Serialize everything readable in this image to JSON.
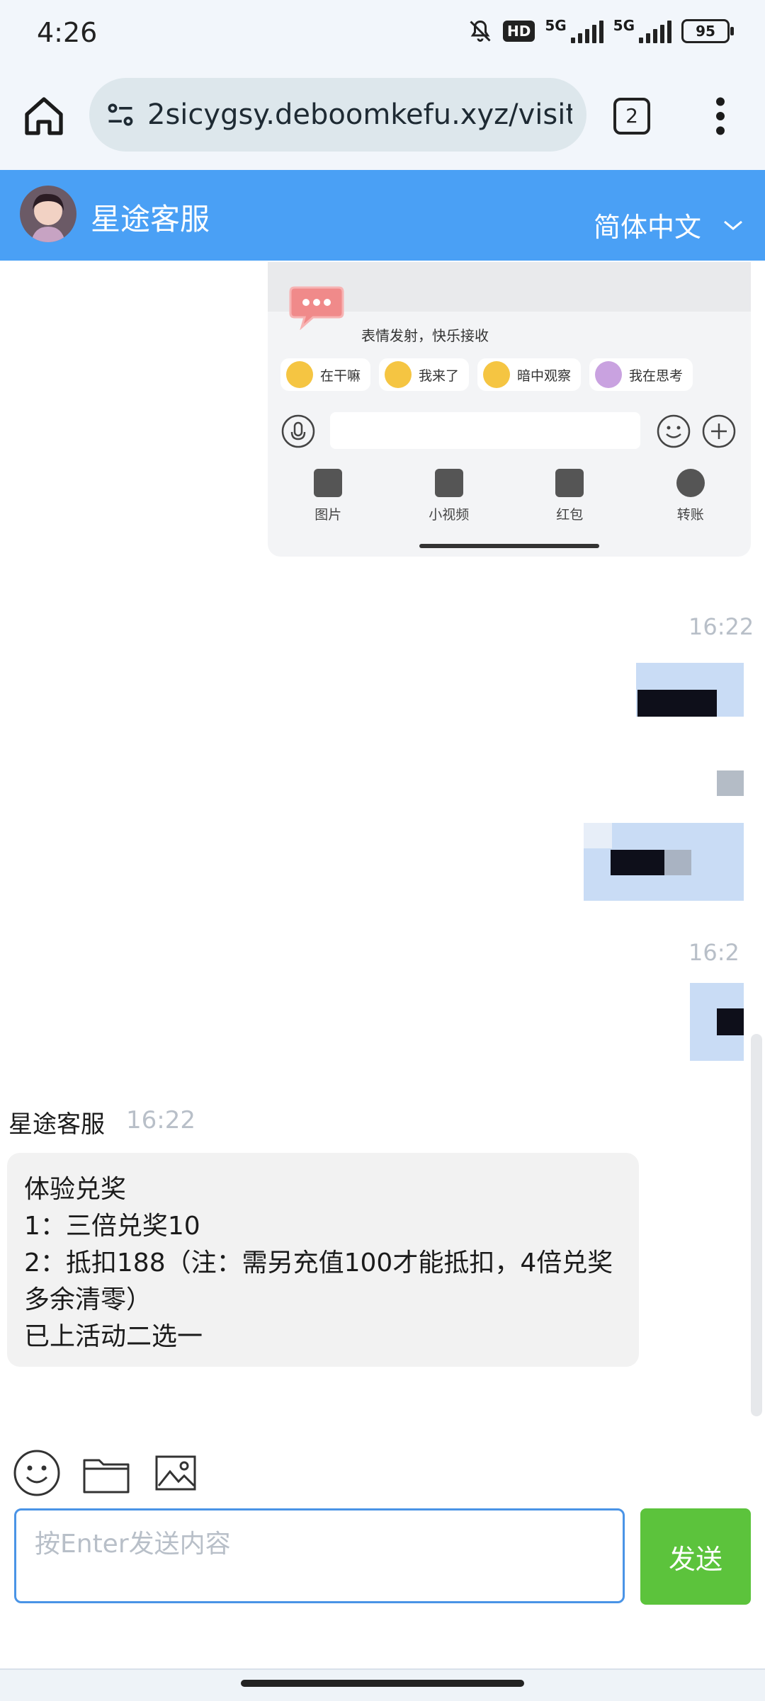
{
  "status_bar": {
    "time": "4:26",
    "hd_badge": "HD",
    "network_1": "5G",
    "network_2": "5G",
    "battery": "95"
  },
  "browser": {
    "url": "2sicygsy.deboomkefu.xyz/visito",
    "tab_count": "2"
  },
  "chat_header": {
    "title": "星途客服",
    "language": "简体中文"
  },
  "embedded_screenshot": {
    "caption": "表情发射，快乐接收",
    "quick_emojis": [
      "在干嘛",
      "我来了",
      "暗中观察",
      "我在思考"
    ],
    "tools": [
      "图片",
      "小视频",
      "红包",
      "转账"
    ]
  },
  "visitor_messages": {
    "stamp_1": "16:22",
    "stamp_3": "16:2"
  },
  "agent_message": {
    "sender": "星途客服",
    "time": "16:22",
    "lines": [
      "体验兑奖",
      "1：三倍兑奖10",
      "2：抵扣188（注：需另充值100才能抵扣，4倍兑奖",
      "多余清零）",
      "已上活动二选一"
    ]
  },
  "composer": {
    "placeholder": "按Enter发送内容",
    "send_label": "发送"
  },
  "colors": {
    "header": "#4aa0f5",
    "send_button": "#5cc33c",
    "visitor_bubble": "#c9dcf5",
    "agent_bubble": "#f2f2f2"
  }
}
